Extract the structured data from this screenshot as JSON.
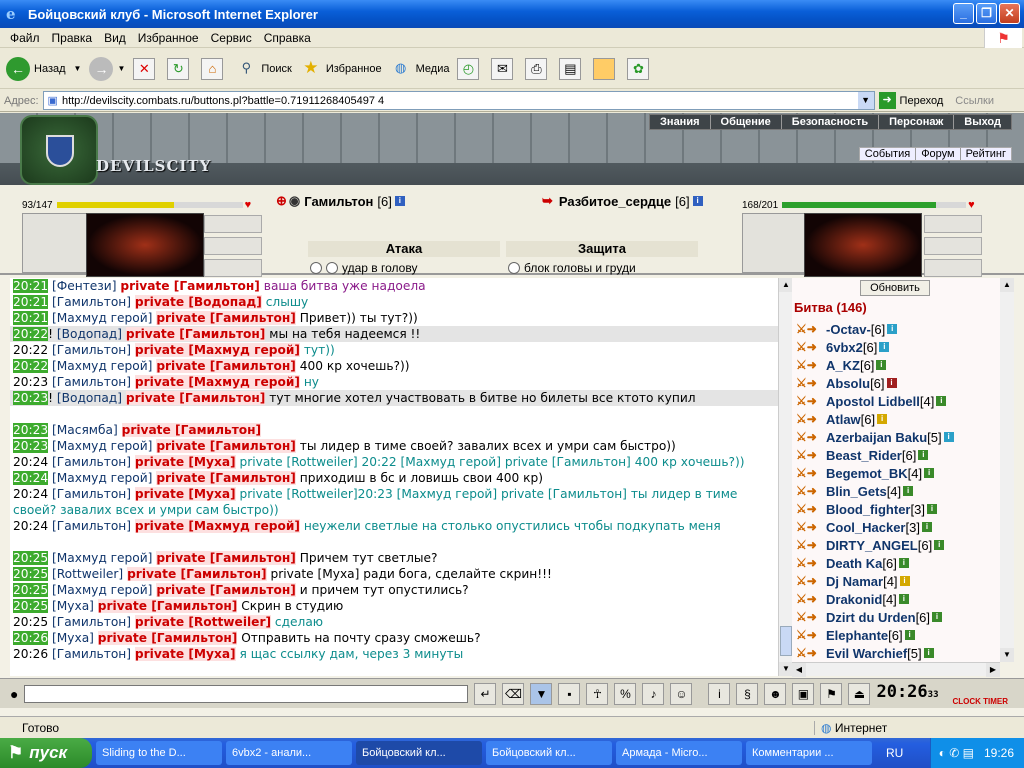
{
  "window": {
    "title": "Бойцовский клуб - Microsoft Internet Explorer"
  },
  "menu": [
    "Файл",
    "Правка",
    "Вид",
    "Избранное",
    "Сервис",
    "Справка"
  ],
  "toolbar": {
    "back": "Назад",
    "search": "Поиск",
    "favorites": "Избранное",
    "media": "Медиа"
  },
  "address": {
    "label": "Адрес:",
    "url": "http://devilscity.combats.ru/buttons.pl?battle=0.71911268405497 4",
    "go": "Переход",
    "links": "Ссылки"
  },
  "site": {
    "brand": "DEVILSCITY",
    "topnav": [
      "Знания",
      "Общение",
      "Безопасность",
      "Персонаж",
      "Выход"
    ],
    "subnav": [
      "События",
      "Форум",
      "Рейтинг"
    ]
  },
  "fight": {
    "left": {
      "hp": "93/147",
      "hp_fraction": 0.633,
      "name": "Гамильтон",
      "level": "[6]"
    },
    "right": {
      "hp": "168/201",
      "hp_fraction": 0.836,
      "name": "Разбитое_сердце",
      "level": "[6]"
    },
    "attack_header": "Атака",
    "defense_header": "Защита",
    "attack_option": "удар в голову",
    "defense_option": "блок головы и груди"
  },
  "chat": [
    {
      "t": "20:21",
      "g": true,
      "nick": "[Фентези]",
      "priv": "private [Гамильтон]",
      "pbg": false,
      "text": "ваша битва уже надоела",
      "color": "pur"
    },
    {
      "t": "20:21",
      "g": true,
      "nick": "[Гамильтон]",
      "priv": "private [Водопад]",
      "pbg": true,
      "text": "слышу",
      "color": "teal"
    },
    {
      "t": "20:21",
      "g": true,
      "nick": "[Махмуд герой]",
      "priv": "private [Гамильтон]",
      "pbg": true,
      "text": "Привет)) ты тут?))",
      "color": ""
    },
    {
      "t": "20:22",
      "g": true,
      "pre": "! ",
      "nick": "[Водопад]",
      "priv": "private [Гамильтон]",
      "pbg": true,
      "text": "мы на тебя надеемся !!",
      "color": "",
      "hl": true
    },
    {
      "t": "20:22",
      "g": false,
      "nick": "[Гамильтон]",
      "priv": "private [Махмуд герой]",
      "pbg": true,
      "text": "тут))",
      "color": "teal"
    },
    {
      "t": "20:22",
      "g": true,
      "nick": "[Махмуд герой]",
      "priv": "private [Гамильтон]",
      "pbg": true,
      "text": "400 кр хочешь?))",
      "color": ""
    },
    {
      "t": "20:23",
      "g": false,
      "nick": "[Гамильтон]",
      "priv": "private [Махмуд герой]",
      "pbg": true,
      "text": "ну",
      "color": "teal"
    },
    {
      "t": "20:23",
      "g": true,
      "pre": "! ",
      "nick": "[Водопад]",
      "priv": "private [Гамильтон]",
      "pbg": true,
      "text": "тут многие хотел участвовать в битве но билеты все ктото купил",
      "color": "",
      "hl": true
    },
    {
      "blank": true
    },
    {
      "t": "20:23",
      "g": true,
      "nick": "[Масямба]",
      "priv": "private [Гамильтон]",
      "pbg": true,
      "text": "",
      "color": ""
    },
    {
      "t": "20:23",
      "g": true,
      "nick": "[Махмуд герой]",
      "priv": "private [Гамильтон]",
      "pbg": true,
      "text": "ты лидер в тиме своей? завалих всех и умри сам быстро))",
      "color": ""
    },
    {
      "t": "20:24",
      "g": false,
      "nick": "[Гамильтон]",
      "priv": "private [Муха]",
      "pbg": true,
      "text": "private [Rottweiler] 20:22 [Махмуд герой] private [Гамильтон] 400 кр хочешь?))",
      "color": "teal",
      "wrap": true
    },
    {
      "t": "20:24",
      "g": true,
      "nick": "[Махмуд герой]",
      "priv": "private [Гамильтон]",
      "pbg": true,
      "text": "приходиш в бс и ловишь свои 400 кр)",
      "color": ""
    },
    {
      "t": "20:24",
      "g": false,
      "nick": "[Гамильтон]",
      "priv": "private [Муха]",
      "pbg": true,
      "text": "private [Rottweiler]20:23 [Махмуд герой] private [Гамильтон] ты лидер в тиме своей? завалих всех и умри сам быстро))",
      "color": "teal",
      "wrap": true
    },
    {
      "t": "20:24",
      "g": false,
      "nick": "[Гамильтон]",
      "priv": "private [Махмуд герой]",
      "pbg": true,
      "text": "неужели светлые на столько опустились чтобы подкупать меня",
      "color": "teal"
    },
    {
      "blank": true
    },
    {
      "t": "20:25",
      "g": true,
      "nick": "[Махмуд герой]",
      "priv": "private [Гамильтон]",
      "pbg": true,
      "text": "Причем тут светлые?",
      "color": ""
    },
    {
      "t": "20:25",
      "g": true,
      "nick": "[Rottweiler]",
      "priv": "private [Гамильтон]",
      "pbg": true,
      "text": "private [Муха] ради бога, сделайте скрин!!!",
      "color": ""
    },
    {
      "t": "20:25",
      "g": true,
      "nick": "[Махмуд герой]",
      "priv": "private [Гамильтон]",
      "pbg": true,
      "text": "и причем тут опустились?",
      "color": ""
    },
    {
      "t": "20:25",
      "g": true,
      "nick": "[Муха]",
      "priv": "private [Гамильтон]",
      "pbg": true,
      "text": "Скрин в студию",
      "color": ""
    },
    {
      "t": "20:25",
      "g": false,
      "nick": "[Гамильтон]",
      "priv": "private [Rottweiler]",
      "pbg": true,
      "text": "сделаю",
      "color": "teal"
    },
    {
      "t": "20:26",
      "g": true,
      "nick": "[Муха]",
      "priv": "private [Гамильтон]",
      "pbg": true,
      "text": "Отправить на почту сразу сможешь?",
      "color": ""
    },
    {
      "t": "20:26",
      "g": false,
      "nick": "[Гамильтон]",
      "priv": "private [Муха]",
      "pbg": true,
      "text": "я щас ссылку дам, через 3 минуты",
      "color": "teal"
    }
  ],
  "side": {
    "refresh": "Обновить",
    "battle": "Битва (146)",
    "users": [
      {
        "n": "-Octav-",
        "l": "[6]",
        "c": "#2ba0c8"
      },
      {
        "n": "6vbx2",
        "l": "[6]",
        "c": "#2ba0c8"
      },
      {
        "n": "A_KZ",
        "l": "[6]",
        "c": "#3a8a2a"
      },
      {
        "n": "Absolu",
        "l": "[6]",
        "c": "#a02020"
      },
      {
        "n": "Apostol Lidbell",
        "l": "[4]",
        "c": "#3a8a2a"
      },
      {
        "n": "Atlaw",
        "l": "[6]",
        "c": "#d4a800"
      },
      {
        "n": "Azerbaijan Baku",
        "l": "[5]",
        "c": "#2ba0c8"
      },
      {
        "n": "Beast_Rider",
        "l": "[6]",
        "c": "#3a8a2a"
      },
      {
        "n": "Begemot_BK",
        "l": "[4]",
        "c": "#3a8a2a"
      },
      {
        "n": "Blin_Gets",
        "l": "[4]",
        "c": "#3a8a2a"
      },
      {
        "n": "Blood_fighter",
        "l": "[3]",
        "c": "#3a8a2a"
      },
      {
        "n": "Cool_Hacker",
        "l": "[3]",
        "c": "#3a8a2a"
      },
      {
        "n": "DIRTY_ANGEL",
        "l": "[6]",
        "c": "#3a8a2a"
      },
      {
        "n": "Death Ka",
        "l": "[6]",
        "c": "#3a8a2a"
      },
      {
        "n": "Dj Namar",
        "l": "[4]",
        "c": "#d4a800"
      },
      {
        "n": "Drakonid",
        "l": "[4]",
        "c": "#3a8a2a"
      },
      {
        "n": "Dzirt du Urden",
        "l": "[6]",
        "c": "#3a8a2a"
      },
      {
        "n": "Elephante",
        "l": "[6]",
        "c": "#3a8a2a"
      },
      {
        "n": "Evil Warchief",
        "l": "[5]",
        "c": "#3a8a2a"
      }
    ]
  },
  "clock": {
    "time": "20:26",
    "sec": "33",
    "label": "CLOCK TIMER"
  },
  "status": {
    "text": "Готово",
    "zone": "Интернет"
  },
  "taskbar": {
    "start": "пуск",
    "tasks": [
      "Sliding to the D...",
      "6vbx2 - анали...",
      "Бойцовский кл...",
      "Бойцовский кл...",
      "Армада - Micro...",
      "Комментарии ..."
    ],
    "lang": "RU",
    "time": "19:26"
  },
  "colors": {
    "accent": "#0a5fd8",
    "chat_time_green": "#3dab2e",
    "private_red": "#cc0000"
  }
}
